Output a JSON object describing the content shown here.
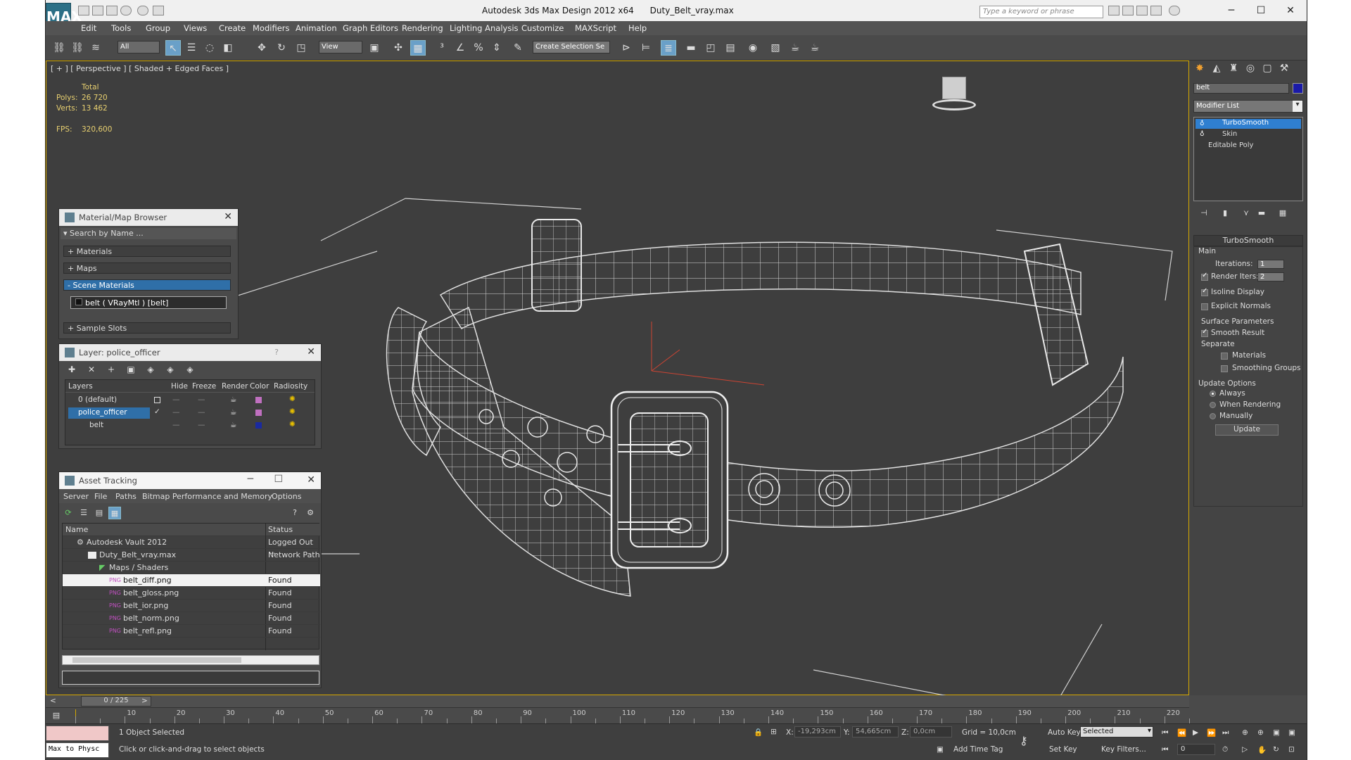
{
  "window": {
    "title": "Autodesk 3ds Max Design 2012 x64      Duty_Belt_vray.max",
    "logo": "MAX",
    "search_placeholder": "Type a keyword or phrase",
    "minimize": "─",
    "maximize": "☐",
    "close": "✕"
  },
  "menu": [
    "Edit",
    "Tools",
    "Group",
    "Views",
    "Create",
    "Modifiers",
    "Animation",
    "Graph Editors",
    "Rendering",
    "Lighting Analysis",
    "Customize",
    "MAXScript",
    "Help"
  ],
  "toolbar": {
    "filter": "All",
    "ref_coord": "View",
    "named_sel": "Create Selection Se"
  },
  "viewport": {
    "label": "[ + ] [ Perspective ] [ Shaded + Edged Faces ]",
    "stats": {
      "total": "Total",
      "polys_label": "Polys:",
      "polys": "26 720",
      "verts_label": "Verts:",
      "verts": "13 462",
      "fps_label": "FPS:",
      "fps": "320,600"
    }
  },
  "material_browser": {
    "title": "Material/Map Browser",
    "search": "Search by Name ...",
    "groups": [
      "+ Materials",
      "+ Maps",
      "- Scene Materials"
    ],
    "scene_item": "belt  ( VRayMtl ) [belt]",
    "sample": "+ Sample Slots"
  },
  "layer": {
    "title": "Layer: police_officer",
    "help": "?",
    "columns": [
      "Layers",
      "Hide",
      "Freeze",
      "Render",
      "Color",
      "Radiosity"
    ],
    "rows": [
      {
        "name": "0 (default)",
        "color": "#c070c0"
      },
      {
        "name": "police_officer",
        "color": "#c070c0"
      },
      {
        "name": "belt",
        "color": "#1a2aa0"
      }
    ],
    "dash": "—"
  },
  "asset": {
    "title": "Asset Tracking",
    "menu": [
      "Server",
      "File",
      "Paths",
      "Bitmap Performance and Memory",
      "Options"
    ],
    "columns": [
      "Name",
      "Status"
    ],
    "rows": [
      {
        "name": "Autodesk Vault 2012",
        "status": "Logged Out ..."
      },
      {
        "name": "Duty_Belt_vray.max",
        "status": "Network Path"
      },
      {
        "name": "Maps / Shaders",
        "status": ""
      },
      {
        "name": "belt_diff.png",
        "status": "Found"
      },
      {
        "name": "belt_gloss.png",
        "status": "Found"
      },
      {
        "name": "belt_ior.png",
        "status": "Found"
      },
      {
        "name": "belt_norm.png",
        "status": "Found"
      },
      {
        "name": "belt_refl.png",
        "status": "Found"
      }
    ]
  },
  "command": {
    "object_name": "belt",
    "obj_color": "#1a1aa8",
    "modifier_list": "Modifier List",
    "stack": [
      "TurboSmooth",
      "Skin",
      "Editable Poly"
    ],
    "rollout": "TurboSmooth",
    "main": "Main",
    "iterations_label": "Iterations:",
    "iterations": "1",
    "render_iters_label": "Render Iters:",
    "render_iters": "2",
    "isoline": "Isoline Display",
    "explicit": "Explicit Normals",
    "surface": "Surface Parameters",
    "smooth": "Smooth Result",
    "separate": "Separate",
    "materials": "Materials",
    "smoothing": "Smoothing Groups",
    "update_options": "Update Options",
    "always": "Always",
    "when_rendering": "When Rendering",
    "manually": "Manually",
    "update": "Update"
  },
  "timeline": {
    "frame": "0 / 225",
    "ticks": [
      "10",
      "20",
      "30",
      "40",
      "50",
      "60",
      "70",
      "80",
      "90",
      "100",
      "110",
      "120",
      "130",
      "140",
      "150",
      "160",
      "170",
      "180",
      "190",
      "200",
      "210",
      "220"
    ]
  },
  "status": {
    "script": "Max to Physc",
    "selected": "1 Object Selected",
    "prompt": "Click or click-and-drag to select objects",
    "x_label": "X:",
    "x": "-19,293cm",
    "y_label": "Y:",
    "y": "54,665cm",
    "z_label": "Z:",
    "z": "0,0cm",
    "grid": "Grid = 10,0cm",
    "add_time_tag": "Add Time Tag",
    "auto_key": "Auto Key",
    "set_key": "Set Key",
    "selected_dd": "Selected",
    "key_filters": "Key Filters...",
    "frame_num": "0"
  }
}
